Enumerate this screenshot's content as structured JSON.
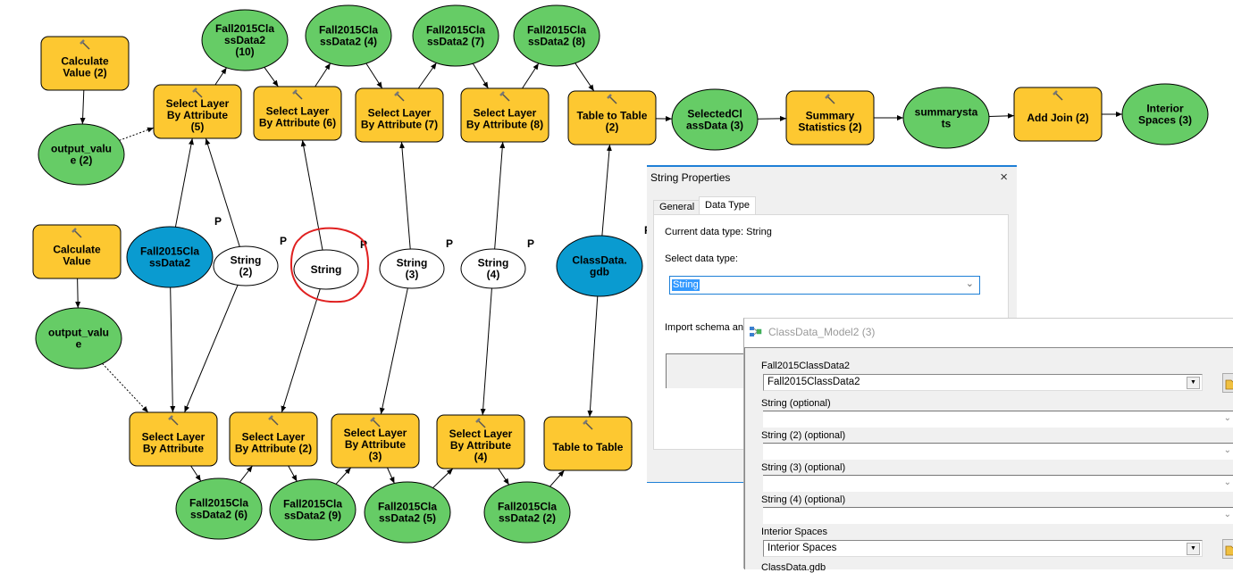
{
  "model": {
    "tools": [
      {
        "id": "calc2",
        "label": [
          "Calculate",
          "Value (2)"
        ]
      },
      {
        "id": "slba5",
        "label": [
          "Select Layer",
          "By Attribute",
          "(5)"
        ]
      },
      {
        "id": "slba6",
        "label": [
          "Select Layer",
          "By Attribute (6)"
        ]
      },
      {
        "id": "slba7",
        "label": [
          "Select Layer",
          "By Attribute (7)"
        ]
      },
      {
        "id": "slba8",
        "label": [
          "Select Layer",
          "By Attribute (8)"
        ]
      },
      {
        "id": "t2t2",
        "label": [
          "Table to Table",
          "(2)"
        ]
      },
      {
        "id": "sumstat2",
        "label": [
          "Summary",
          "Statistics (2)"
        ]
      },
      {
        "id": "addjoin2",
        "label": [
          "Add Join (2)"
        ]
      },
      {
        "id": "calc",
        "label": [
          "Calculate",
          "Value"
        ]
      },
      {
        "id": "slba",
        "label": [
          "Select Layer",
          "By Attribute"
        ]
      },
      {
        "id": "slba2",
        "label": [
          "Select Layer",
          "By Attribute (2)"
        ]
      },
      {
        "id": "slba3",
        "label": [
          "Select Layer",
          "By Attribute",
          "(3)"
        ]
      },
      {
        "id": "slba4",
        "label": [
          "Select Layer",
          "By Attribute",
          "(4)"
        ]
      },
      {
        "id": "t2t",
        "label": [
          "Table to Table"
        ]
      }
    ],
    "variables": [
      {
        "id": "f10",
        "type": "derived",
        "label": [
          "Fall2015Cla",
          "ssData2",
          "(10)"
        ]
      },
      {
        "id": "f4",
        "type": "derived",
        "label": [
          "Fall2015Cla",
          "ssData2 (4)"
        ]
      },
      {
        "id": "f7",
        "type": "derived",
        "label": [
          "Fall2015Cla",
          "ssData2 (7)"
        ]
      },
      {
        "id": "f8",
        "type": "derived",
        "label": [
          "Fall2015Cla",
          "ssData2 (8)"
        ]
      },
      {
        "id": "sel3",
        "type": "derived",
        "label": [
          "SelectedCl",
          "assData (3)"
        ]
      },
      {
        "id": "sumstats",
        "type": "derived",
        "label": [
          "summarysta",
          "ts"
        ]
      },
      {
        "id": "int3",
        "type": "derived",
        "label": [
          "Interior",
          "Spaces (3)"
        ]
      },
      {
        "id": "out2",
        "type": "derived",
        "label": [
          "output_valu",
          "e (2)"
        ]
      },
      {
        "id": "out",
        "type": "derived",
        "label": [
          "output_valu",
          "e"
        ]
      },
      {
        "id": "fin",
        "type": "input",
        "label": [
          "Fall2015Cla",
          "ssData2"
        ],
        "param": "P"
      },
      {
        "id": "s2",
        "type": "value",
        "label": [
          "String",
          "(2)"
        ],
        "param": "P"
      },
      {
        "id": "s",
        "type": "value",
        "label": [
          "String"
        ],
        "param": "P",
        "highlighted": true
      },
      {
        "id": "s3",
        "type": "value",
        "label": [
          "String",
          "(3)"
        ],
        "param": "P"
      },
      {
        "id": "s4",
        "type": "value",
        "label": [
          "String",
          "(4)"
        ],
        "param": "P"
      },
      {
        "id": "gdb",
        "type": "input",
        "label": [
          "ClassData.",
          "gdb"
        ],
        "param": "P"
      },
      {
        "id": "f6",
        "type": "derived",
        "label": [
          "Fall2015Cla",
          "ssData2 (6)"
        ]
      },
      {
        "id": "f9",
        "type": "derived",
        "label": [
          "Fall2015Cla",
          "ssData2 (9)"
        ]
      },
      {
        "id": "f5",
        "type": "derived",
        "label": [
          "Fall2015Cla",
          "ssData2 (5)"
        ]
      },
      {
        "id": "f2",
        "type": "derived",
        "label": [
          "Fall2015Cla",
          "ssData2 (2)"
        ]
      }
    ],
    "colors": {
      "tool": "#fdc831",
      "derived": "#66cc66",
      "input": "#0a9bd0",
      "value": "#ffffff",
      "highlight": "#e02020"
    }
  },
  "string_properties": {
    "title": "String Properties",
    "close_icon": "×",
    "tabs": [
      {
        "label": "General"
      },
      {
        "label": "Data Type",
        "active": true
      }
    ],
    "current_type": "Current data type: String",
    "select_label": "Select data type:",
    "select_value": "String",
    "import_label": "Import schema and"
  },
  "model_dialog": {
    "title": "ClassData_Model2 (3)",
    "params": [
      {
        "label": "Fall2015ClassData2",
        "value": "Fall2015ClassData2",
        "kind": "combo"
      },
      {
        "label": "String (optional)",
        "value": "",
        "kind": "field"
      },
      {
        "label": "String (2) (optional)",
        "value": "",
        "kind": "field"
      },
      {
        "label": "String (3) (optional)",
        "value": "",
        "kind": "field"
      },
      {
        "label": "String (4) (optional)",
        "value": "",
        "kind": "field"
      },
      {
        "label": "Interior Spaces",
        "value": "Interior Spaces",
        "kind": "combo"
      },
      {
        "label": "ClassData.gdb",
        "value": "",
        "kind": "cut"
      }
    ]
  }
}
